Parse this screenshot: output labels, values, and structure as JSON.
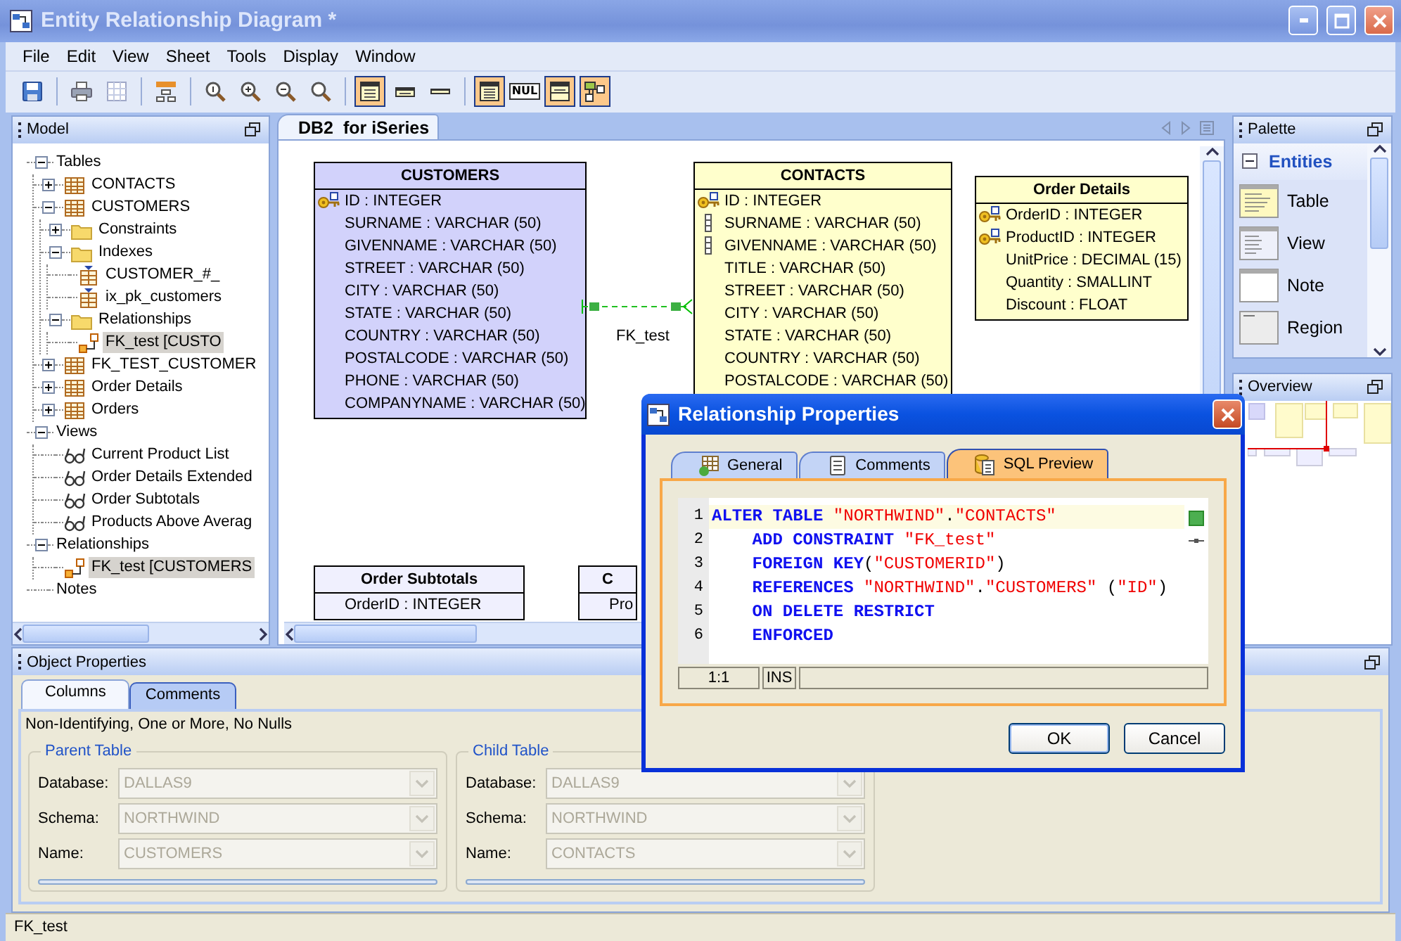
{
  "window": {
    "title": "Entity Relationship Diagram *"
  },
  "menu": [
    "File",
    "Edit",
    "View",
    "Sheet",
    "Tools",
    "Display",
    "Window"
  ],
  "toolbar": [
    {
      "kind": "save"
    },
    {
      "kind": "separator"
    },
    {
      "kind": "print"
    },
    {
      "kind": "grid"
    },
    {
      "kind": "separator"
    },
    {
      "kind": "layout"
    },
    {
      "kind": "separator"
    },
    {
      "kind": "zoom-actual"
    },
    {
      "kind": "zoom-in"
    },
    {
      "kind": "zoom-out"
    },
    {
      "kind": "zoom-fit"
    },
    {
      "kind": "separator"
    },
    {
      "kind": "entity-view",
      "selected": true
    },
    {
      "kind": "name-view",
      "selected": false
    },
    {
      "kind": "title-view",
      "selected": false
    },
    {
      "kind": "separator"
    },
    {
      "kind": "columns",
      "selected": true
    },
    {
      "kind": "nulls",
      "label": "NUL",
      "selected": false
    },
    {
      "kind": "comments",
      "selected": true
    },
    {
      "kind": "relations",
      "selected": true
    }
  ],
  "model": {
    "title": "Model",
    "tree": [
      {
        "label": "Tables",
        "kind": "category",
        "expanded": true,
        "selected": false,
        "children": [
          {
            "label": "CONTACTS",
            "kind": "table",
            "expanded": false,
            "selected": false
          },
          {
            "label": "CUSTOMERS",
            "kind": "table",
            "expanded": true,
            "selected": false,
            "children": [
              {
                "label": "Constraints",
                "kind": "folder",
                "expanded": false,
                "selected": false
              },
              {
                "label": "Indexes",
                "kind": "folder",
                "expanded": true,
                "selected": false,
                "children": [
                  {
                    "label": "CUSTOMER_#_",
                    "kind": "index",
                    "selected": false
                  },
                  {
                    "label": "ix_pk_customers",
                    "kind": "index",
                    "selected": false
                  }
                ]
              },
              {
                "label": "Relationships",
                "kind": "folder",
                "expanded": true,
                "selected": false,
                "children": [
                  {
                    "label": "FK_test [CUSTO",
                    "kind": "relationship",
                    "selected": true
                  }
                ]
              }
            ]
          },
          {
            "label": "FK_TEST_CUSTOMER",
            "kind": "table",
            "expanded": false,
            "selected": false
          },
          {
            "label": "Order Details",
            "kind": "table",
            "expanded": false,
            "selected": false
          },
          {
            "label": "Orders",
            "kind": "table",
            "expanded": false,
            "selected": false
          }
        ]
      },
      {
        "label": "Views",
        "kind": "category",
        "expanded": true,
        "selected": false,
        "children": [
          {
            "label": "Current Product List",
            "kind": "view",
            "selected": false
          },
          {
            "label": "Order Details Extended",
            "kind": "view",
            "selected": false
          },
          {
            "label": "Order Subtotals",
            "kind": "view",
            "selected": false
          },
          {
            "label": "Products Above Averag",
            "kind": "view",
            "selected": false
          }
        ]
      },
      {
        "label": "Relationships",
        "kind": "category",
        "expanded": true,
        "selected": false,
        "children": [
          {
            "label": "FK_test [CUSTOMERS",
            "kind": "relationship",
            "selected": true
          }
        ]
      },
      {
        "label": "Notes",
        "kind": "category",
        "selected": false
      }
    ]
  },
  "editor": {
    "tab": "DB2  for iSeries",
    "entities": [
      {
        "name": "CUSTOMERS",
        "color": "#d2d2fb",
        "columns": [
          {
            "text": "ID : INTEGER",
            "kind": "primary"
          },
          {
            "text": "SURNAME : VARCHAR (50)",
            "kind": "plain"
          },
          {
            "text": "GIVENNAME : VARCHAR (50)",
            "kind": "plain"
          },
          {
            "text": "STREET : VARCHAR (50)",
            "kind": "plain"
          },
          {
            "text": "CITY : VARCHAR (50)",
            "kind": "plain"
          },
          {
            "text": "STATE : VARCHAR (50)",
            "kind": "plain"
          },
          {
            "text": "COUNTRY : VARCHAR (50)",
            "kind": "plain"
          },
          {
            "text": "POSTALCODE : VARCHAR (50)",
            "kind": "plain"
          },
          {
            "text": "PHONE : VARCHAR (50)",
            "kind": "plain"
          },
          {
            "text": "COMPANYNAME : VARCHAR (50)",
            "kind": "plain"
          }
        ]
      },
      {
        "name": "CONTACTS",
        "color": "#ffffcc",
        "columns": [
          {
            "text": "ID : INTEGER",
            "kind": "primary"
          },
          {
            "text": "SURNAME : VARCHAR (50)",
            "kind": "index"
          },
          {
            "text": "GIVENNAME : VARCHAR (50)",
            "kind": "index"
          },
          {
            "text": "TITLE : VARCHAR (50)",
            "kind": "plain"
          },
          {
            "text": "STREET : VARCHAR (50)",
            "kind": "plain"
          },
          {
            "text": "CITY : VARCHAR (50)",
            "kind": "plain"
          },
          {
            "text": "STATE : VARCHAR (50)",
            "kind": "plain"
          },
          {
            "text": "COUNTRY : VARCHAR (50)",
            "kind": "plain"
          },
          {
            "text": "POSTALCODE : VARCHAR (50)",
            "kind": "plain"
          }
        ]
      },
      {
        "name": "Order Details",
        "color": "#ffffcc",
        "columns": [
          {
            "text": "OrderID : INTEGER",
            "kind": "primary"
          },
          {
            "text": "ProductID : INTEGER",
            "kind": "primary"
          },
          {
            "text": "UnitPrice : DECIMAL (15)",
            "kind": "plain"
          },
          {
            "text": "Quantity : SMALLINT",
            "kind": "plain"
          },
          {
            "text": "Discount : FLOAT",
            "kind": "plain"
          }
        ]
      },
      {
        "name": "Order Subtotals",
        "color": "#f0f0fe",
        "columns": [
          {
            "text": "OrderID : INTEGER",
            "kind": "plain"
          }
        ]
      },
      {
        "name": "C",
        "color": "#f0f0fe",
        "columns": [
          {
            "text": "Pro",
            "kind": "plain"
          }
        ]
      }
    ],
    "relationships": [
      {
        "label": "FK_test"
      }
    ]
  },
  "palette": {
    "title": "Palette",
    "group": {
      "label": "Entities",
      "expanded": true,
      "items": [
        {
          "label": "Table",
          "kind": "table"
        },
        {
          "label": "View",
          "kind": "view"
        },
        {
          "label": "Note",
          "kind": "note"
        },
        {
          "label": "Region",
          "kind": "region"
        }
      ]
    }
  },
  "overview": {
    "title": "Overview"
  },
  "properties": {
    "title": "Object Properties",
    "tabs": [
      {
        "label": "Columns",
        "selected": true
      },
      {
        "label": "Comments",
        "selected": false
      }
    ],
    "summary": "Non-Identifying, One or More, No Nulls",
    "groups": [
      {
        "title": "Parent Table",
        "fields": [
          {
            "label": "Database:",
            "value": "DALLAS9",
            "disabled": true
          },
          {
            "label": "Schema:",
            "value": "NORTHWIND",
            "disabled": true
          },
          {
            "label": "Name:",
            "value": "CUSTOMERS",
            "disabled": true
          }
        ]
      },
      {
        "title": "Child Table",
        "fields": [
          {
            "label": "Database:",
            "value": "DALLAS9",
            "disabled": true
          },
          {
            "label": "Schema:",
            "value": "NORTHWIND",
            "disabled": true
          },
          {
            "label": "Name:",
            "value": "CONTACTS",
            "disabled": true
          }
        ]
      }
    ]
  },
  "status_bar": "FK_test",
  "dialog": {
    "title": "Relationship Properties",
    "tabs": [
      {
        "label": "General",
        "kind": "general",
        "selected": false
      },
      {
        "label": "Comments",
        "kind": "comments",
        "selected": false
      },
      {
        "label": "SQL Preview",
        "kind": "sql",
        "selected": true
      }
    ],
    "code": [
      {
        "number": "1",
        "current": true,
        "tokens": [
          {
            "kind": "keyword",
            "text": "ALTER TABLE "
          },
          {
            "kind": "string",
            "text": "\"NORTHWIND\""
          },
          {
            "kind": "plain",
            "text": "."
          },
          {
            "kind": "string",
            "text": "\"CONTACTS\""
          }
        ]
      },
      {
        "number": "2",
        "current": false,
        "tokens": [
          {
            "kind": "keyword",
            "text": "    ADD CONSTRAINT "
          },
          {
            "kind": "string",
            "text": "\"FK_test\""
          }
        ]
      },
      {
        "number": "3",
        "current": false,
        "tokens": [
          {
            "kind": "keyword",
            "text": "    FOREIGN KEY"
          },
          {
            "kind": "plain",
            "text": "("
          },
          {
            "kind": "string",
            "text": "\"CUSTOMERID\""
          },
          {
            "kind": "plain",
            "text": ")"
          }
        ]
      },
      {
        "number": "4",
        "current": false,
        "tokens": [
          {
            "kind": "keyword",
            "text": "    REFERENCES "
          },
          {
            "kind": "string",
            "text": "\"NORTHWIND\""
          },
          {
            "kind": "plain",
            "text": "."
          },
          {
            "kind": "string",
            "text": "\"CUSTOMERS\""
          },
          {
            "kind": "plain",
            "text": " ("
          },
          {
            "kind": "string",
            "text": "\"ID\""
          },
          {
            "kind": "plain",
            "text": ")"
          }
        ]
      },
      {
        "number": "5",
        "current": false,
        "tokens": [
          {
            "kind": "keyword",
            "text": "    ON DELETE RESTRICT"
          }
        ]
      },
      {
        "number": "6",
        "current": false,
        "tokens": [
          {
            "kind": "keyword",
            "text": "    ENFORCED"
          }
        ]
      }
    ],
    "status": [
      "1:1",
      "INS"
    ],
    "buttons": [
      "OK",
      "Cancel"
    ]
  }
}
